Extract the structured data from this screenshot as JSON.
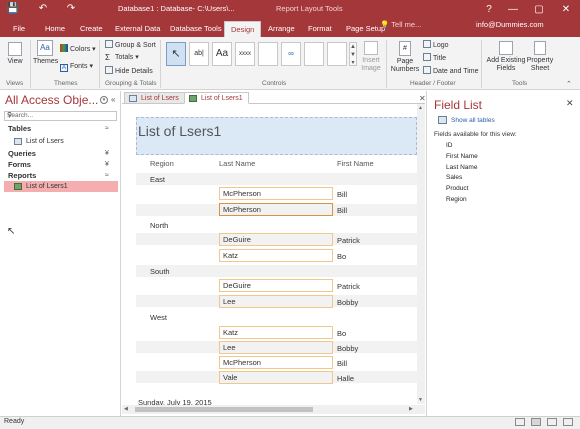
{
  "titlebar": {
    "title": "Database1 : Database- C:\\Users\\...",
    "context": "Report Layout Tools",
    "quick_access": {
      "save": "💾",
      "undo": "↶",
      "redo": "↷"
    },
    "window": {
      "help": "?",
      "minimize": "—",
      "restore": "▢",
      "close": "✕"
    }
  },
  "tabs": [
    "File",
    "Home",
    "Create",
    "External Data",
    "Database Tools",
    "Design",
    "Arrange",
    "Format",
    "Page Setup"
  ],
  "active_tab": "Design",
  "tell_me": "Tell me...",
  "account": "info@Dummies.com",
  "ribbon": {
    "views_label": "View",
    "themes_label": "Themes",
    "colors_label": "Colors",
    "fonts_label": "Fonts",
    "group_sort": "Group & Sort",
    "totals": "Totals",
    "hide_details": "Hide Details",
    "insert_image": "Insert Image",
    "page_numbers": "Page Numbers",
    "logo": "Logo",
    "title": "Title",
    "date_time": "Date and Time",
    "add_existing_fields": "Add Existing Fields",
    "property_sheet": "Property Sheet",
    "controls": {
      "select": "↖",
      "textbox": "ab|",
      "label": "Aa",
      "button": "xxxx"
    },
    "groups": {
      "views": "Views",
      "themes": "Themes",
      "grouping": "Grouping & Totals",
      "controls": "Controls",
      "header_footer": "Header / Footer",
      "tools": "Tools"
    }
  },
  "nav": {
    "title": "All Access Obje...",
    "search_placeholder": "Search...",
    "sections": [
      {
        "name": "Tables",
        "chevron": "≈",
        "items": [
          "List of Lsers"
        ]
      },
      {
        "name": "Queries",
        "chevron": "¥",
        "items": []
      },
      {
        "name": "Forms",
        "chevron": "¥",
        "items": []
      },
      {
        "name": "Reports",
        "chevron": "≈",
        "items": [
          "List of Lsers1"
        ]
      }
    ]
  },
  "doc_tabs": [
    "List of Lsers",
    "List of Lsers1"
  ],
  "active_doc_tab": "List of Lsers1",
  "report": {
    "title": "List of Lsers1",
    "columns": [
      "Region",
      "Last Name",
      "First Name"
    ],
    "groups": [
      {
        "region": "East",
        "rows": [
          {
            "last": "McPherson",
            "first": "Bill"
          },
          {
            "last": "McPherson",
            "first": "Bill"
          }
        ]
      },
      {
        "region": "North",
        "rows": [
          {
            "last": "DeGuire",
            "first": "Patrick"
          },
          {
            "last": "Katz",
            "first": "Bo"
          }
        ]
      },
      {
        "region": "South",
        "rows": [
          {
            "last": "DeGuire",
            "first": "Patrick"
          },
          {
            "last": "Lee",
            "first": "Bobby"
          }
        ]
      },
      {
        "region": "West",
        "rows": [
          {
            "last": "Katz",
            "first": "Bo"
          },
          {
            "last": "Lee",
            "first": "Bobby"
          },
          {
            "last": "McPherson",
            "first": "Bill"
          },
          {
            "last": "Vale",
            "first": "Halle"
          }
        ]
      }
    ],
    "footer_date": "Sunday, July 19, 2015"
  },
  "field_list": {
    "title": "Field List",
    "show_all": "Show all tables",
    "subtitle": "Fields available for this view:",
    "fields": [
      "ID",
      "First Name",
      "Last Name",
      "Sales",
      "Product",
      "Region"
    ]
  },
  "status": {
    "text": "Ready"
  },
  "colors": {
    "accent": "#a4373a",
    "selected_item": "#f4aeb0",
    "field_border": "#f0c88d"
  }
}
